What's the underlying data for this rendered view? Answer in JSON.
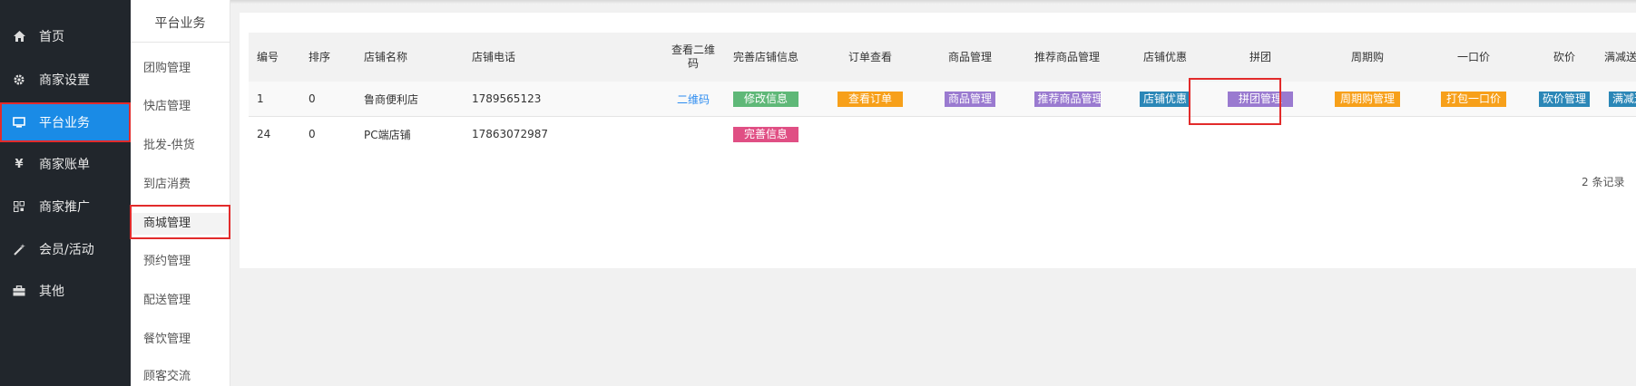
{
  "sidebar": {
    "items": [
      {
        "label": "首页",
        "icon": "home-icon"
      },
      {
        "label": "商家设置",
        "icon": "gear-icon"
      },
      {
        "label": "平台业务",
        "icon": "monitor-icon",
        "active": true
      },
      {
        "label": "商家账单",
        "icon": "yen-icon"
      },
      {
        "label": "商家推广",
        "icon": "qrcode-icon"
      },
      {
        "label": "会员/活动",
        "icon": "magic-wand-icon"
      },
      {
        "label": "其他",
        "icon": "briefcase-icon"
      }
    ]
  },
  "submenu": {
    "title": "平台业务",
    "items": [
      {
        "label": "团购管理"
      },
      {
        "label": "快店管理"
      },
      {
        "label": "批发-供货"
      },
      {
        "label": "到店消费"
      },
      {
        "label": "商城管理",
        "active": true
      },
      {
        "label": "预约管理"
      },
      {
        "label": "配送管理"
      },
      {
        "label": "餐饮管理"
      },
      {
        "label": "顾客交流"
      }
    ]
  },
  "table": {
    "headers": {
      "id": "编号",
      "sort": "排序",
      "name": "店铺名称",
      "phone": "店铺电话",
      "qr_line1": "查看二维",
      "qr_line2": "码",
      "info": "完善店铺信息",
      "orders": "订单查看",
      "goods": "商品管理",
      "recommend": "推荐商品管理",
      "discount": "店铺优惠",
      "group": "拼团",
      "periodic": "周期购",
      "fixed": "一口价",
      "bargain": "砍价",
      "full": "满减送"
    },
    "rows": [
      {
        "id": "1",
        "sort": "0",
        "name": "鲁商便利店",
        "phone": "1789565123",
        "qr": "二维码",
        "info_btn": "修改信息",
        "orders_btn": "查看订单",
        "goods_btn": "商品管理",
        "recommend_btn": "推荐商品管理",
        "discount_btn": "店铺优惠",
        "group_btn": "拼团管理",
        "periodic_btn": "周期购管理",
        "fixed_btn": "打包一口价",
        "bargain_btn": "砍价管理",
        "full_btn": "满减送"
      },
      {
        "id": "24",
        "sort": "0",
        "name": "PC端店铺",
        "phone": "17863072987",
        "info_btn": "完善信息"
      }
    ]
  },
  "pager": {
    "text": "2 条记录"
  },
  "colors": {
    "sidebar_bg": "#21262c",
    "active_blue": "#1a8be6",
    "highlight_red": "#e22b2b",
    "btn_green": "#5fb878",
    "btn_orange": "#f7a01a",
    "btn_purple": "#9a7ad0",
    "btn_blue": "#2b87b7",
    "btn_pink": "#e04f84"
  }
}
